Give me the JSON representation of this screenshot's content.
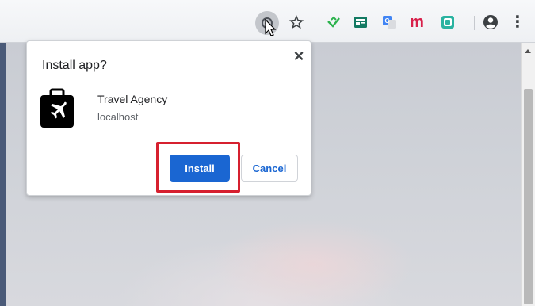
{
  "dialog": {
    "title": "Install app?",
    "app_name": "Travel Agency",
    "app_origin": "localhost",
    "install_label": "Install",
    "cancel_label": "Cancel",
    "close_glyph": "×"
  },
  "toolbar": {
    "icons": [
      "install-app-icon",
      "bookmark-star-icon",
      "extension-feedly-icon",
      "extension-card-icon",
      "google-translate-icon",
      "extension-m-icon",
      "extension-green-icon",
      "profile-avatar-icon",
      "more-menu-icon"
    ],
    "extension_m_label": "m",
    "more_glyph": "⋮"
  },
  "colors": {
    "install_button": "#1a66d2",
    "highlight": "#d6202f",
    "extension_m": "#d8204a"
  }
}
